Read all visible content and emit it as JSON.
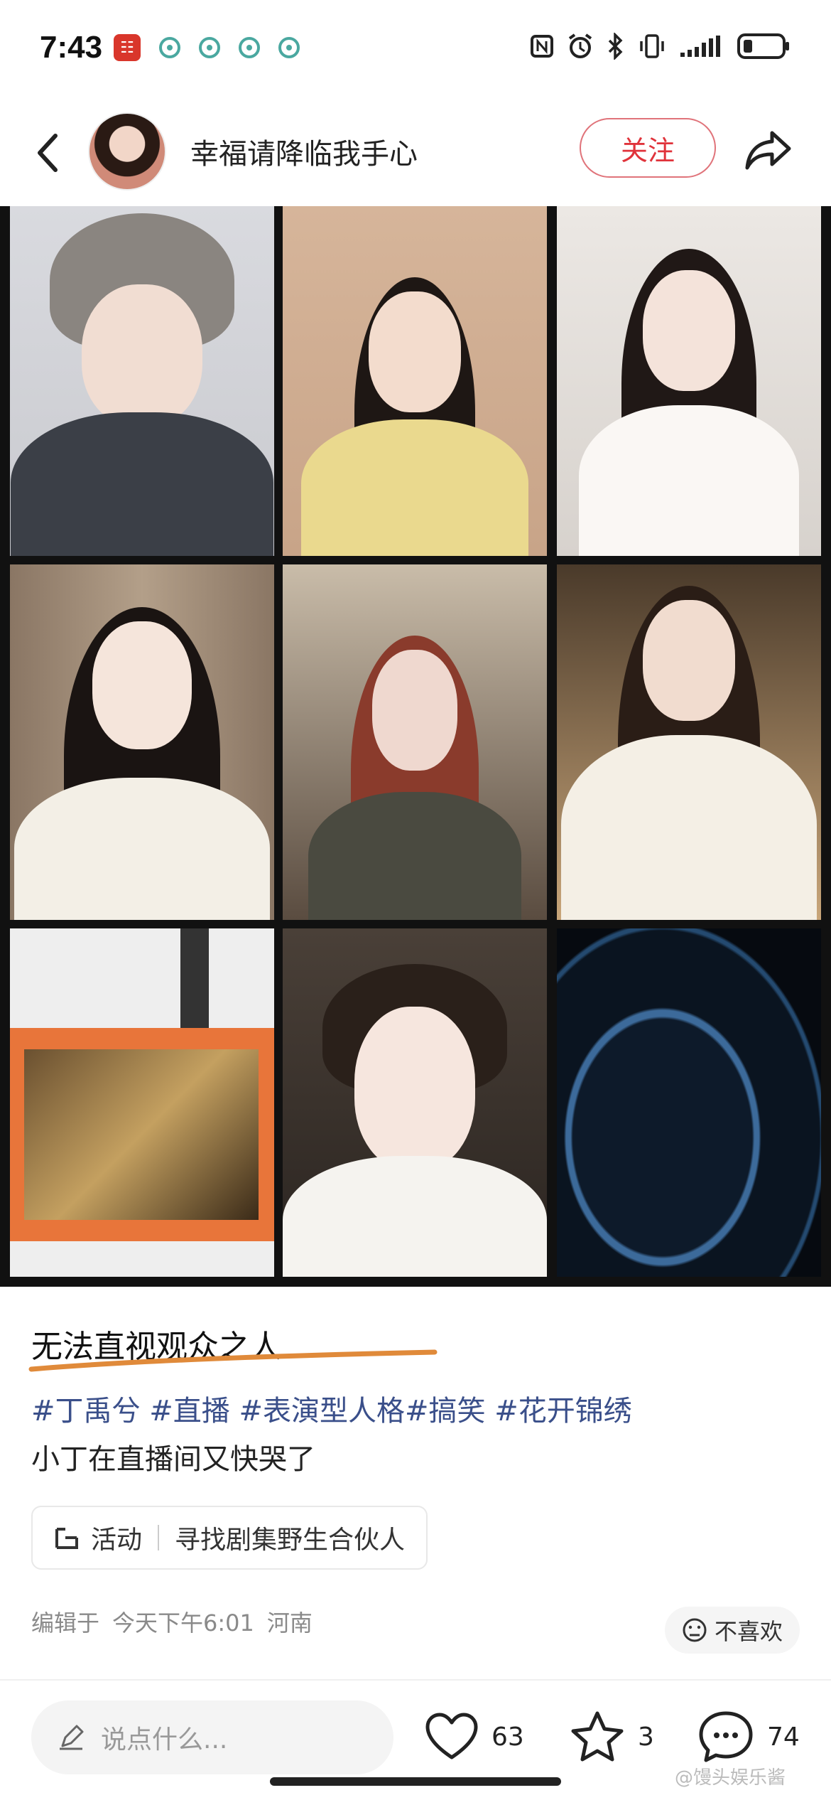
{
  "status_bar": {
    "time": "7:43",
    "left_icons": [
      "bank-app-icon",
      "signal-app-icon",
      "signal-app-icon",
      "signal-app-icon",
      "signal-app-icon"
    ],
    "right_icons": [
      "nfc-icon",
      "alarm-icon",
      "bluetooth-icon",
      "vibrate-icon",
      "wifi-signal-icon",
      "battery-icon"
    ]
  },
  "header": {
    "username": "幸福请降临我手心",
    "follow_label": "关注"
  },
  "post": {
    "title": "无法直视观众之人",
    "hashtags": "#丁禹兮 #直播 #表演型人格#搞笑 #花开锦绣",
    "description": "小丁在直播间又快哭了",
    "activity_label": "活动",
    "activity_text": "寻找剧集野生合伙人",
    "edited_prefix": "编辑于",
    "edited_time": "今天下午6:01",
    "location": "河南",
    "dislike_label": "不喜欢"
  },
  "bottom_bar": {
    "comment_placeholder": "说点什么...",
    "like_count": "63",
    "favorite_count": "3",
    "comment_count": "74"
  },
  "watermark": "@馒头娱乐酱",
  "colors": {
    "accent": "#e0333b",
    "hashtag": "#3a4f8a",
    "underline": "#e08a3a"
  }
}
